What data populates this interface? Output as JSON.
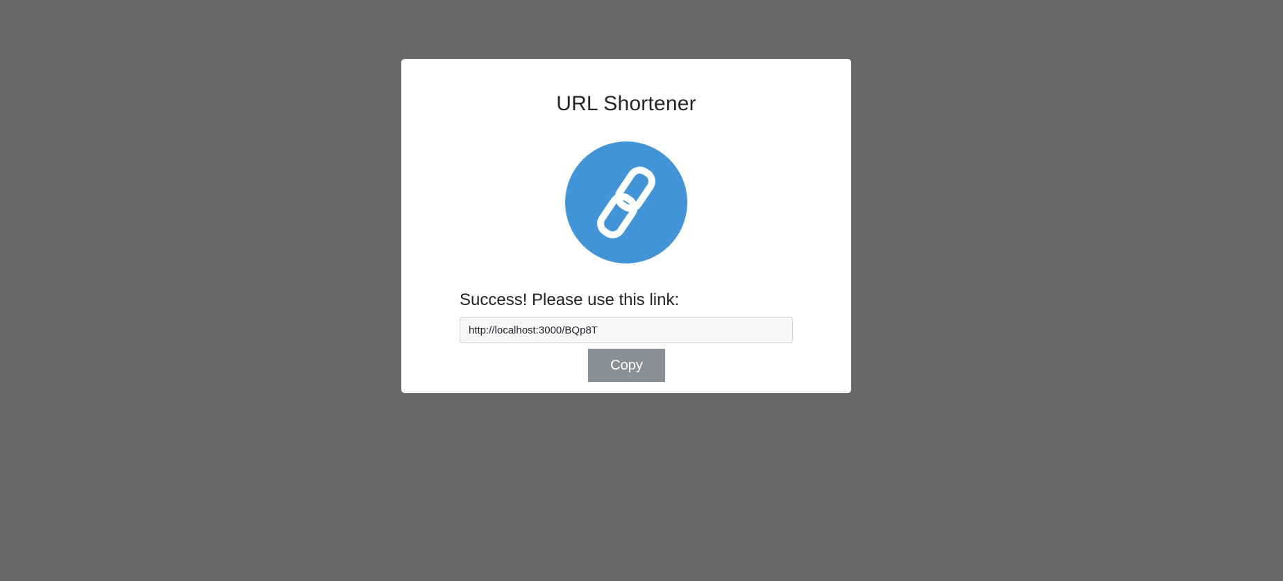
{
  "app": {
    "title": "URL Shortener",
    "logo_icon": "chain-link-icon",
    "accent_color": "#4194d8"
  },
  "result": {
    "message": "Success! Please use this link:",
    "short_url": "http://localhost:3000/BQp8T"
  },
  "actions": {
    "copy_label": "Copy"
  }
}
